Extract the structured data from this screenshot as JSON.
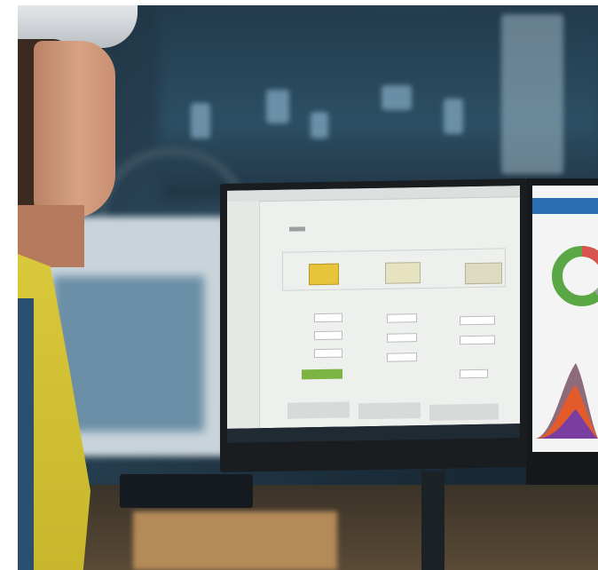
{
  "scene": {
    "description_colors": {
      "background": "#1d3140",
      "screen": "#eef0ee",
      "accent_yellow": "#e7c43a",
      "accent_green": "#7cb342",
      "donut_red": "#d9534f",
      "donut_green": "#5aa845",
      "vest_yellow": "#d9c83a"
    },
    "left_monitor": {
      "icons": [
        "display-1-icon",
        "display-2-icon",
        "display-3-icon"
      ]
    },
    "right_monitor": {
      "donut_segments": [
        {
          "color": "#d9534f",
          "fraction": 0.2
        },
        {
          "color": "#9aa09e",
          "fraction": 0.3
        },
        {
          "color": "#5aa845",
          "fraction": 0.5
        }
      ],
      "area_colors": [
        "#8e6b7a",
        "#e35b2b",
        "#7a3ea0"
      ]
    }
  }
}
